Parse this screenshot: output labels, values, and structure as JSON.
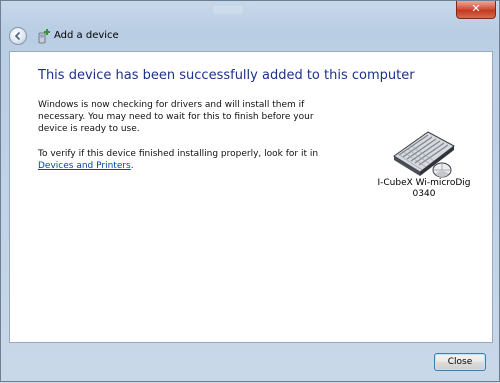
{
  "window": {
    "close_glyph": "✕"
  },
  "nav": {
    "back_icon": "back-arrow-icon",
    "title": "Add a device"
  },
  "content": {
    "heading": "This device has been successfully added to this computer",
    "paragraph1": "Windows is now checking for drivers and will install them if necessary. You may need to wait for this to finish before your device is ready to use.",
    "paragraph2_text": "To verify if this device finished installing properly, look for it in",
    "paragraph2_link": "Devices and Printers",
    "paragraph2_end": "."
  },
  "device": {
    "icon": "keyboard-mouse-icon",
    "name_line1": "I-CubeX Wi-microDig",
    "name_line2": "0340"
  },
  "footer": {
    "close_label": "Close"
  },
  "colors": {
    "heading": "#1e3287",
    "link": "#0645ad",
    "frame": "#c9d8e9"
  }
}
